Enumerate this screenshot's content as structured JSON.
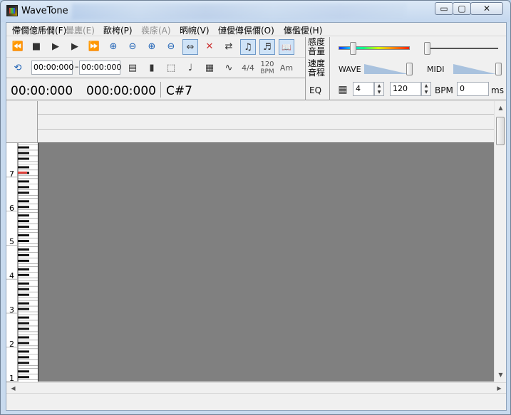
{
  "window": {
    "title": "WaveTone",
    "min_glyph": "▭",
    "max_glyph": "▢",
    "close_glyph": "✕"
  },
  "menu": [
    {
      "label": "僀儞億乕僩(F)",
      "disabled": false
    },
    {
      "label": "曇廤(E)",
      "disabled": true
    },
    {
      "label": "歃桍(P)",
      "disabled": false
    },
    {
      "label": "彂庩(A)",
      "disabled": true
    },
    {
      "label": "昞帵(V)",
      "disabled": false
    },
    {
      "label": "僆僾僔儑儞(O)",
      "disabled": false
    },
    {
      "label": "僿儖僾(H)",
      "disabled": false
    }
  ],
  "toolbar1": {
    "rewind_icon": "⏪",
    "stop_icon": "■",
    "step_play_icon": "▶︎",
    "play_icon": "▶",
    "fast_forward_icon": "⏩",
    "zoom_in_h_icon": "⊕",
    "zoom_out_h_icon": "⊖",
    "zoom_in_v_icon": "⊕",
    "zoom_out_v_icon": "⊖",
    "fit_icon": "⇔",
    "split_icon": "✕",
    "swap_icon": "⇄",
    "wave1_icon": "♫",
    "wave2_icon": "♬",
    "book_icon": "📖"
  },
  "toolbar2": {
    "loop_icon": "⟲",
    "time_start": "00:00:000",
    "time_end": "00:00:000",
    "dash": "–",
    "layout_icon": "▤",
    "pen_icon": "▮",
    "select_icon": "⬚",
    "note_icon": "♩",
    "grid_icon": "▦",
    "curve_icon": "∿",
    "time_sig": "4/4",
    "tempo_line1": "120",
    "tempo_line2": "BPM",
    "key": "Am"
  },
  "position": {
    "time_display": "00:00:000",
    "time_display2": "000:00:000",
    "note": "C#7"
  },
  "levels": {
    "sensitivity_line1": "感度",
    "sensitivity_line2": "音量",
    "speed_line1": "速度",
    "speed_line2": "音程",
    "eq_label": "EQ",
    "wave_label": "WAVE",
    "midi_label": "MIDI",
    "grid_icon": "▦",
    "beats_value": "4",
    "bpm_value": "120",
    "bpm_label": "BPM",
    "offset_value": "0",
    "offset_unit": "ms",
    "spin_up": "▲",
    "spin_down": "▼"
  },
  "keyboard": {
    "octaves": [
      "7",
      "6",
      "5",
      "4",
      "3",
      "2",
      "1"
    ]
  },
  "scroll": {
    "up": "▲",
    "down": "▼",
    "left": "◀",
    "right": "▶"
  }
}
